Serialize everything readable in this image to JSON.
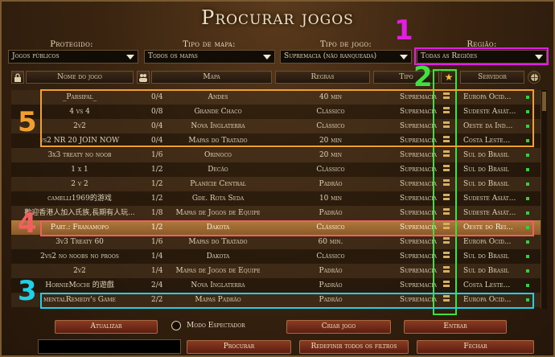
{
  "title": "Procurar jogos",
  "filters": [
    {
      "label": "Protegido:",
      "value": "Jogos públicos"
    },
    {
      "label": "Tipo de mapa:",
      "value": "Todos os mapas"
    },
    {
      "label": "Tipo de jogo:",
      "value": "Supremacia (não ranqueada)"
    },
    {
      "label": "Região:",
      "value": "Todas as Regiões"
    }
  ],
  "columns": {
    "name": "Nome do jogo",
    "map": "Mapa",
    "rules": "Regras",
    "type": "Tipo",
    "star": "★",
    "server": "Servidor"
  },
  "rows": [
    {
      "name": "_Parsifal_",
      "players": "0/4",
      "map": "Andes",
      "rules": "40 min",
      "type": "Supremacia",
      "server": "Europa Ocid..."
    },
    {
      "name": "4 vs 4",
      "players": "0/8",
      "map": "Grande Chaco",
      "rules": "Clássico",
      "type": "Supremacia",
      "server": "Sudeste Asiát..."
    },
    {
      "name": "2v2",
      "players": "0/4",
      "map": "Nova Inglaterra",
      "rules": "Clássico",
      "type": "Supremacia",
      "server": "Oeste da Ind..."
    },
    {
      "name": "vs2 NR 20 JOIN NOW",
      "players": "0/4",
      "map": "Mapas do Tratado",
      "rules": "20 min",
      "type": "Supremacia",
      "server": "Costa Leste..."
    },
    {
      "name": "3x3 treaty no noob",
      "players": "1/6",
      "map": "Orinoco",
      "rules": "20 min",
      "type": "Supremacia",
      "server": "Sul do Brasil"
    },
    {
      "name": "1 x 1",
      "players": "1/2",
      "map": "Decão",
      "rules": "Clássico",
      "type": "Supremacia",
      "server": "Sul do Brasil"
    },
    {
      "name": "2 v 2",
      "players": "1/2",
      "map": "Planície Central",
      "rules": "Padrão",
      "type": "Supremacia",
      "server": "Sul do Brasil"
    },
    {
      "name": "camelli1969的游戏",
      "players": "1/2",
      "map": "Gde. Rota Seda",
      "rules": "10 min",
      "type": "Supremacia",
      "server": "Sudeste Asiát..."
    },
    {
      "name": "歡迎香港人加入氏族,長期有人玩...",
      "players": "1/8",
      "map": "Mapas de Jogos de Equipe",
      "rules": "Padrão",
      "type": "Supremacia",
      "server": "Sudeste Asiát..."
    },
    {
      "name": "Part.: Franamopo",
      "players": "1/2",
      "map": "Dakota",
      "rules": "Clássico",
      "type": "Supremacia",
      "server": "Oeste do Rei..."
    },
    {
      "name": "3v3 Treaty 60",
      "players": "1/6",
      "map": "Mapas do Tratado",
      "rules": "60 min.",
      "type": "Supremacia",
      "server": "Europa Ocid..."
    },
    {
      "name": "2vs2 no noobs no proos",
      "players": "1/4",
      "map": "Dakota",
      "rules": "Clássico",
      "type": "Supremacia",
      "server": "Sul do Brasil"
    },
    {
      "name": "2v2",
      "players": "1/4",
      "map": "Mapas de Jogos de Equipe",
      "rules": "Padrão",
      "type": "Supremacia",
      "server": "Sul do Brasil"
    },
    {
      "name": "HornieMochi 的遊戲",
      "players": "2/4",
      "map": "Nova Inglaterra",
      "rules": "Padrão",
      "type": "Supremacia",
      "server": "Costa Leste..."
    },
    {
      "name": "mentalRemedy's Game",
      "players": "2/2",
      "map": "Mapas Padrão",
      "rules": "Padrão",
      "type": "Supremacia",
      "server": "Europa Ocid..."
    }
  ],
  "buttons": {
    "refresh": "Atualizar",
    "spectator": "Modo Espectador",
    "create": "Criar jogo",
    "join": "Entrar",
    "search": "Procurar",
    "reset": "Redefinir todos os filtros",
    "close": "Fechar"
  },
  "annotations": [
    "1",
    "2",
    "3",
    "4",
    "5"
  ],
  "colors": {
    "magenta": "#e020e0",
    "green": "#40e040",
    "cyan": "#20d0e8",
    "red": "#f06060",
    "orange": "#f0a030"
  }
}
